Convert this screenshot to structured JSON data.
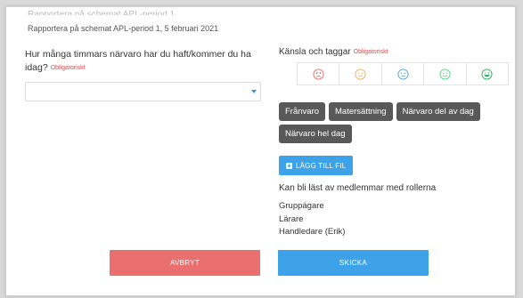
{
  "modal": {
    "clipped_title": "Rapportera på schemat APL-period 1",
    "subtitle": "Rapportera på schemat APL-period 1, 5 februari 2021"
  },
  "hours": {
    "question": "Hur många timmars närvaro har du haft/kommer du ha idag?",
    "required": "Obligatoriskt",
    "value": ""
  },
  "feelings": {
    "label": "Känsla och taggar",
    "required": "Obligatoriskt",
    "moods": [
      {
        "icon": "very-sad-face-icon",
        "color": "#e5736f"
      },
      {
        "icon": "neutral-face-icon",
        "color": "#f0b15a"
      },
      {
        "icon": "calm-face-icon",
        "color": "#4aa3df"
      },
      {
        "icon": "happy-face-icon",
        "color": "#5bcf8e"
      },
      {
        "icon": "very-happy-face-icon",
        "color": "#2cae5e"
      }
    ]
  },
  "tags": [
    "Frånvaro",
    "Matersättning",
    "Närvaro del av dag",
    "Närvaro hel dag"
  ],
  "attachment": {
    "add_file_label": "LÄGG TILL FIL"
  },
  "visibility": {
    "label": "Kan bli läst av medlemmar med rollerna",
    "roles": [
      "Gruppägare",
      "Lärare",
      "Handledare (Erik)"
    ]
  },
  "actions": {
    "cancel_label": "AVBRYT",
    "send_label": "SKICKA"
  },
  "colors": {
    "danger": "#ea6f6f",
    "primary": "#3da2e8",
    "tag_bg": "#595959",
    "required": "#e34a4a"
  }
}
